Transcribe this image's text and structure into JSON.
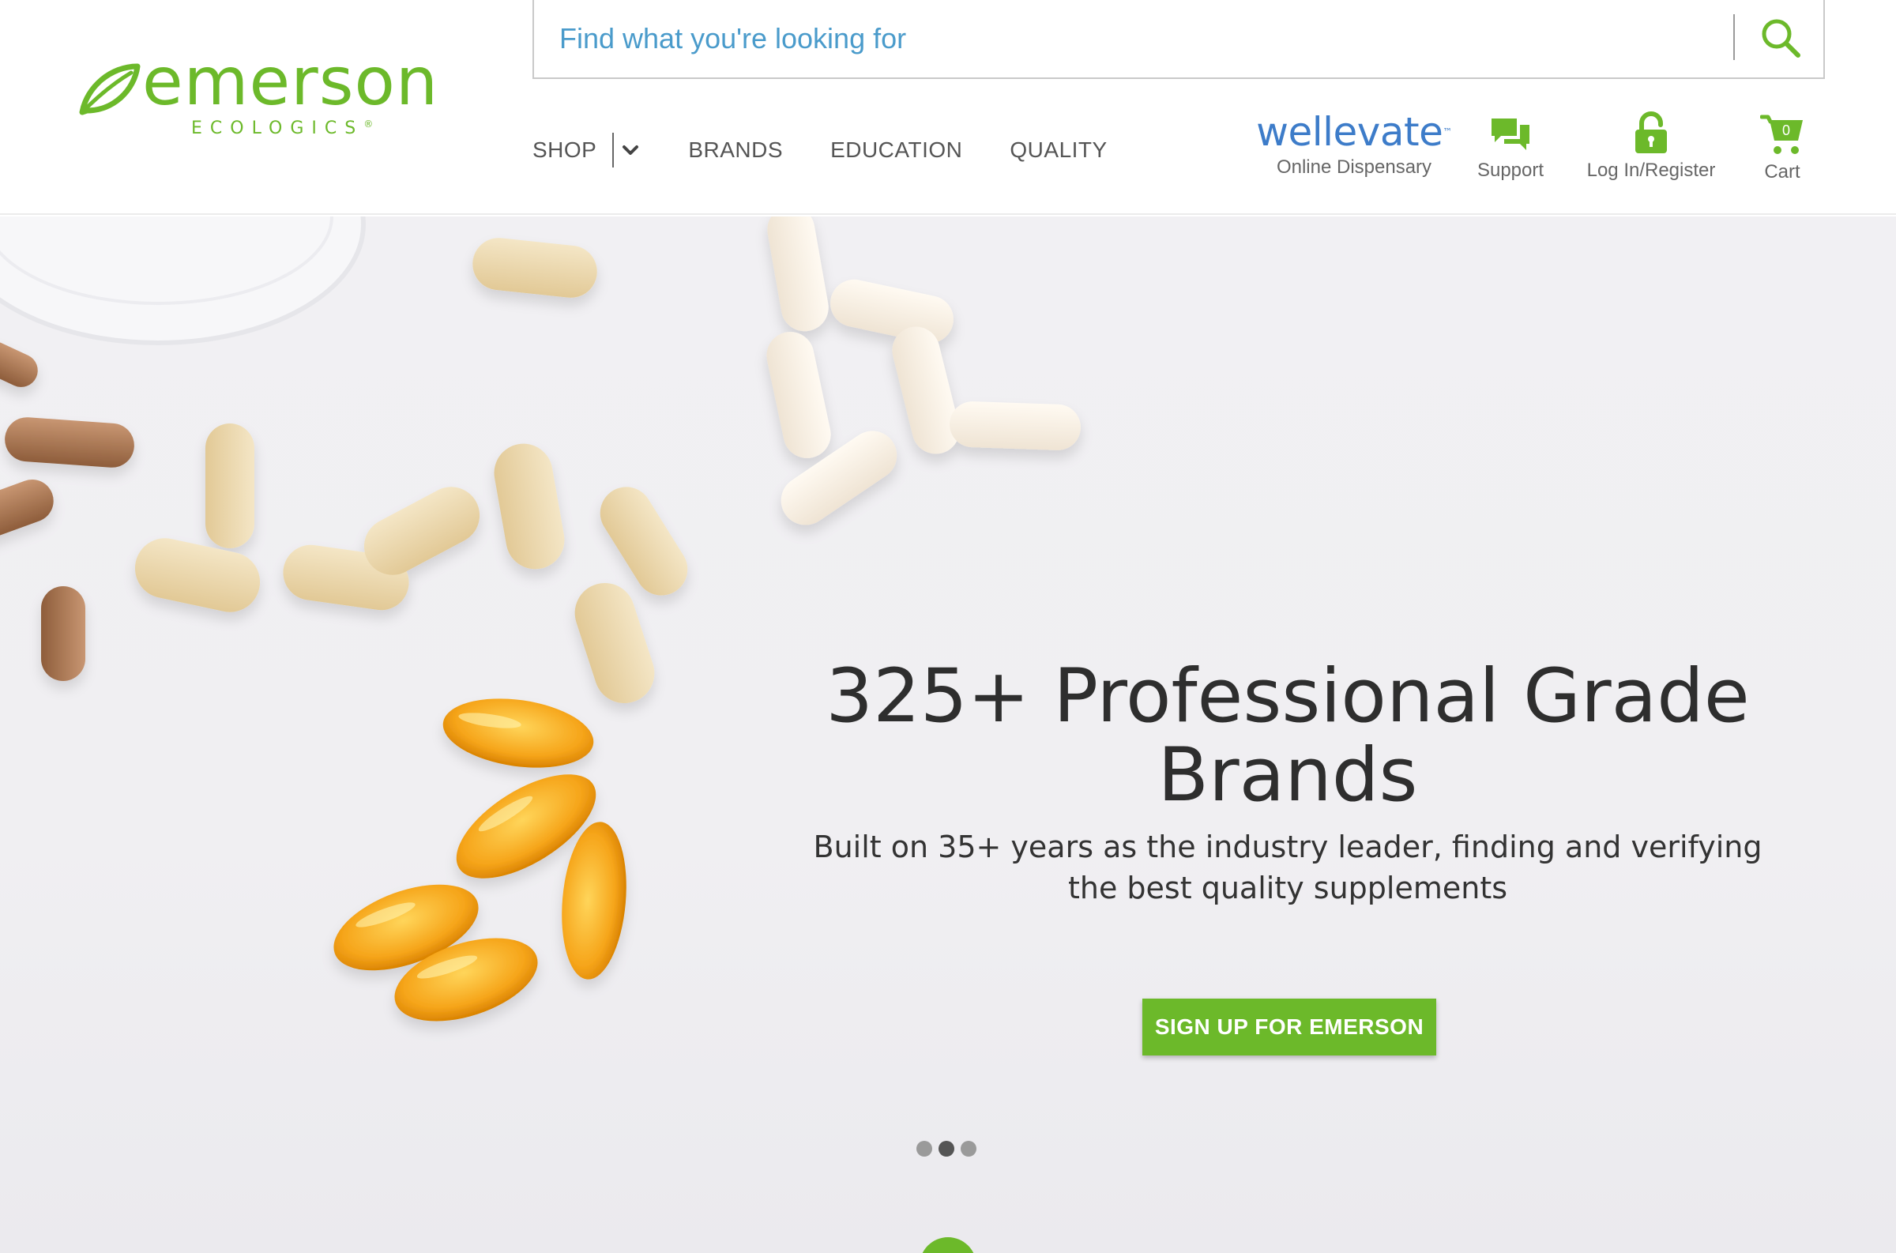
{
  "brand": {
    "logo_word": "emerson",
    "logo_sub": "ECOLOGICS",
    "logo_mark": "®",
    "accent_color": "#6cb92a"
  },
  "search": {
    "placeholder": "Find what you're looking for",
    "icon": "search-icon"
  },
  "nav": {
    "shop": "SHOP",
    "brands": "BRANDS",
    "education": "EDUCATION",
    "quality": "QUALITY"
  },
  "utility": {
    "wellevate_logo": "wellevate",
    "wellevate_mark": "™",
    "wellevate_label": "Online Dispensary",
    "support_label": "Support",
    "login_label": "Log In/Register",
    "cart_label": "Cart",
    "cart_count": "0",
    "wellevate_color": "#3d7cc9"
  },
  "hero": {
    "title": "325+ Professional Grade Brands",
    "subtitle": "Built on 35+ years as the industry leader, finding and verifying the best quality supplements",
    "cta": "SIGN UP FOR EMERSON",
    "carousel_count": 3,
    "carousel_active": 2
  }
}
